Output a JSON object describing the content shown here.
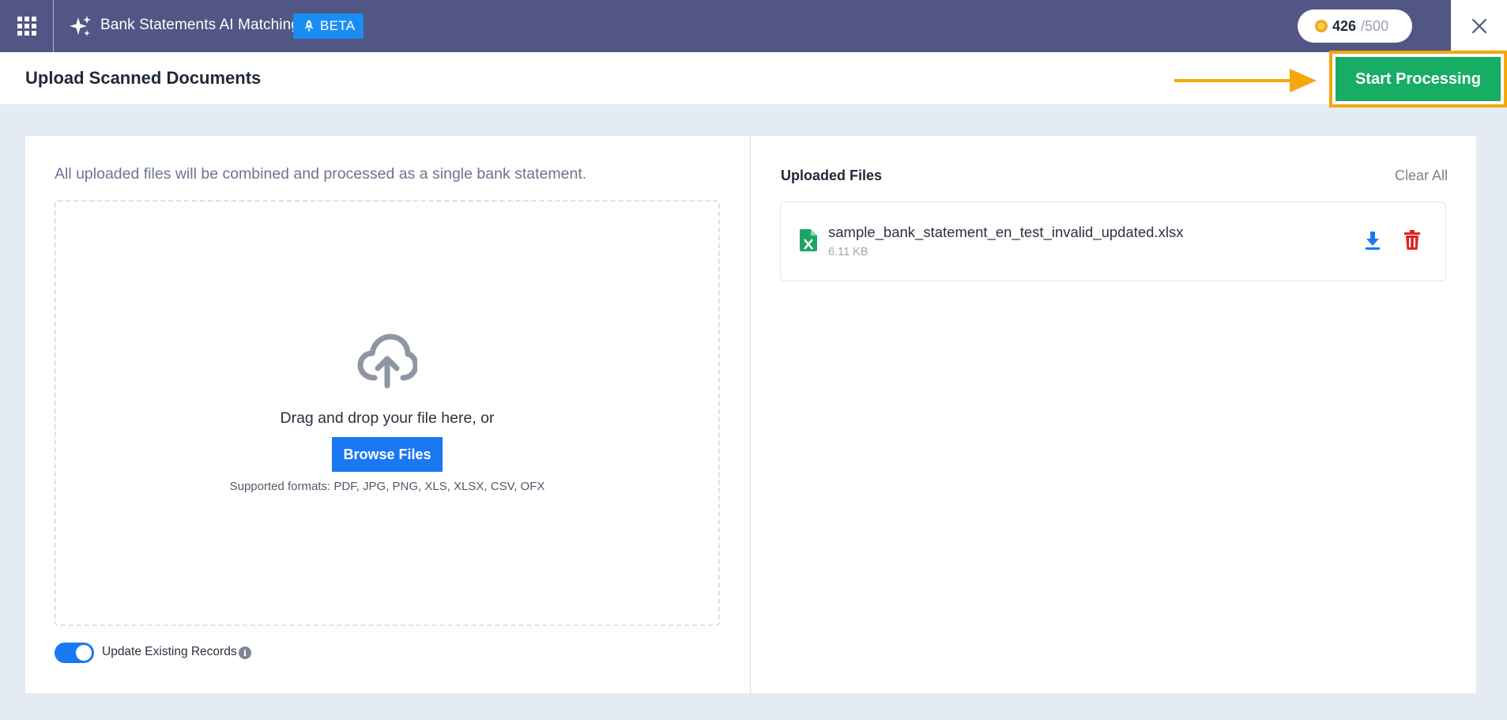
{
  "topbar": {
    "apps_icon": "apps-grid-icon",
    "app_icon": "sparkles-icon",
    "app_title": "Bank Statements AI Matching",
    "badge": {
      "label": "BETA",
      "icon": "rocket-icon",
      "color": "#1a8df2"
    },
    "credits": {
      "used": "426",
      "total": "/500",
      "icon": "coin-icon"
    },
    "close_icon": "close-icon",
    "background": "#515685"
  },
  "header": {
    "title": "Upload Scanned Documents",
    "start_button": "Start Processing",
    "start_button_color": "#18ad65",
    "highlight_color": "#f5a60b"
  },
  "upload": {
    "note": "All uploaded files will be combined and processed as a single bank statement.",
    "drop_icon": "cloud-upload-icon",
    "drag_text": "Drag and drop your file here, or",
    "browse_button": "Browse Files",
    "formats": "Supported formats: PDF, JPG, PNG, XLS, XLSX, CSV, OFX",
    "toggle": {
      "label": "Update Existing Records",
      "checked": true,
      "info_icon": "info-icon"
    }
  },
  "files": {
    "title": "Uploaded Files",
    "clear_all": "Clear All",
    "items": [
      {
        "name": "sample_bank_statement_en_test_invalid_updated.xlsx",
        "size": "6.11 KB",
        "icon": "excel-file-icon"
      }
    ]
  },
  "colors": {
    "accent": "#1a78f2",
    "danger": "#e02424",
    "excel": "#1fa463"
  }
}
